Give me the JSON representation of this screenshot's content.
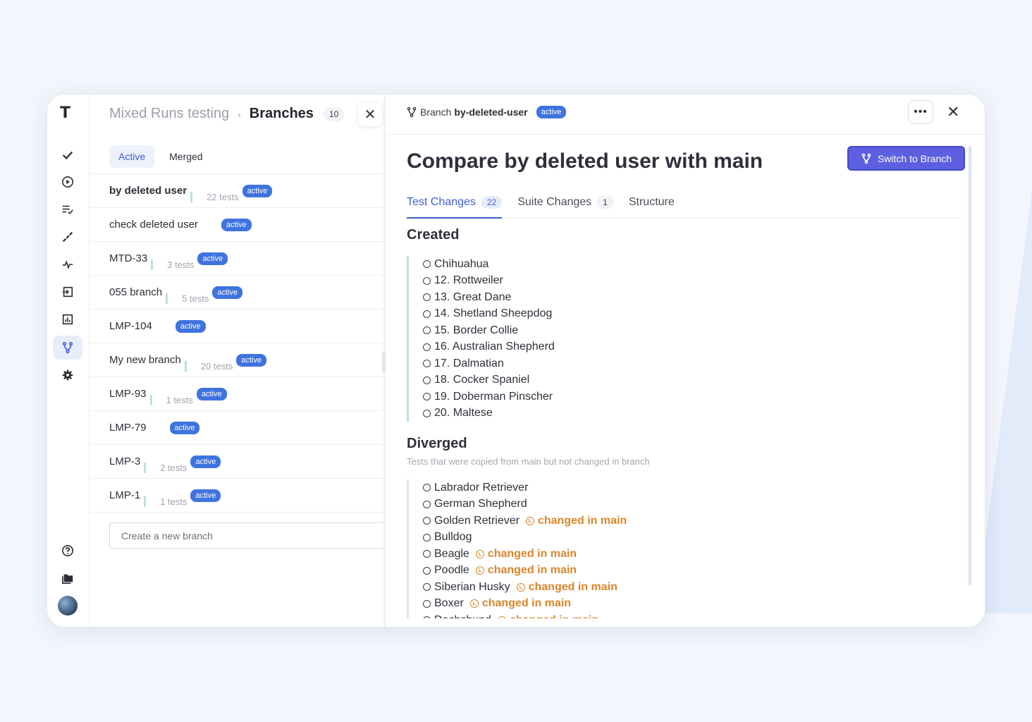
{
  "breadcrumb": {
    "parent": "Mixed Runs testing",
    "current": "Branches",
    "count": "10"
  },
  "filters": [
    {
      "label": "Active",
      "active": true
    },
    {
      "label": "Merged",
      "active": false
    }
  ],
  "branches": [
    {
      "name": "by deleted user",
      "tests": "22 tests",
      "badge": "active"
    },
    {
      "name": "check deleted user",
      "tests": "",
      "badge": "active"
    },
    {
      "name": "MTD-33",
      "tests": "3 tests",
      "badge": "active"
    },
    {
      "name": "055 branch",
      "tests": "5 tests",
      "badge": "active"
    },
    {
      "name": "LMP-104",
      "tests": "",
      "badge": "active"
    },
    {
      "name": "My new branch",
      "tests": "20 tests",
      "badge": "active"
    },
    {
      "name": "LMP-93",
      "tests": "1 tests",
      "badge": "active"
    },
    {
      "name": "LMP-79",
      "tests": "",
      "badge": "active"
    },
    {
      "name": "LMP-3",
      "tests": "2 tests",
      "badge": "active"
    },
    {
      "name": "LMP-1",
      "tests": "1 tests",
      "badge": "active"
    }
  ],
  "create_placeholder": "Create a new branch",
  "detail": {
    "header_prefix": "Branch",
    "branch_name": "by-deleted-user",
    "status": "active",
    "more_label": "•••",
    "close_label": "✕",
    "title": "Compare by deleted user with main",
    "switch_label": "Switch to Branch",
    "tabs": [
      {
        "label": "Test Changes",
        "count": "22"
      },
      {
        "label": "Suite Changes",
        "count": "1"
      },
      {
        "label": "Structure",
        "count": ""
      }
    ],
    "created_title": "Created",
    "created": [
      "Chihuahua",
      "12. Rottweiler",
      "13. Great Dane",
      "14. Shetland Sheepdog",
      "15. Border Collie",
      "16. Australian Shepherd",
      "17. Dalmatian",
      "18. Cocker Spaniel",
      "19. Doberman Pinscher",
      "20. Maltese"
    ],
    "diverged_title": "Diverged",
    "diverged_subtitle": "Tests that were copied from main but not changed in branch",
    "changed_label": "changed in main",
    "diverged": [
      {
        "name": "Labrador Retriever",
        "changed": false
      },
      {
        "name": "German Shepherd",
        "changed": false
      },
      {
        "name": "Golden Retriever",
        "changed": true
      },
      {
        "name": "Bulldog",
        "changed": false
      },
      {
        "name": "Beagle",
        "changed": true
      },
      {
        "name": "Poodle",
        "changed": true
      },
      {
        "name": "Siberian Husky",
        "changed": true
      },
      {
        "name": "Boxer",
        "changed": true
      },
      {
        "name": "Dachshund",
        "changed": true
      }
    ]
  },
  "colors": {
    "accent": "#3f5fd1",
    "badge": "#3f74e0",
    "button": "#5b5fe0",
    "warning": "#d9862a"
  }
}
